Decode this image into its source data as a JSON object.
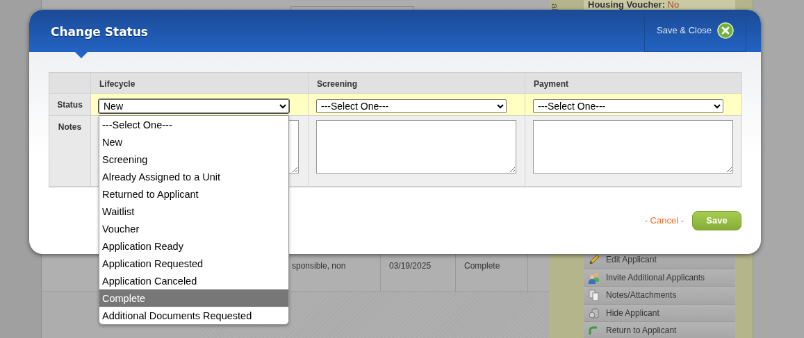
{
  "background": {
    "header_field": {
      "label": "Housing Voucher:",
      "value": "No"
    },
    "tab_label": "ai",
    "table_row": [
      "sponsible, non",
      "03/19/2025",
      "Complete"
    ],
    "side_menu": [
      {
        "label": "Edit Applicant"
      },
      {
        "label": "Invite Additional Applicants"
      },
      {
        "label": "Notes/Attachments"
      },
      {
        "label": "Hide Applicant"
      },
      {
        "label": "Return to Applicant"
      }
    ]
  },
  "modal": {
    "title": "Change Status",
    "save_close": "Save & Close",
    "columns": [
      "Lifecycle",
      "Screening",
      "Payment"
    ],
    "row_labels": [
      "Status",
      "Notes"
    ],
    "selects": [
      {
        "value": "New",
        "expanded": true
      },
      {
        "value": "---Select One---",
        "expanded": false
      },
      {
        "value": "---Select One---",
        "expanded": false
      }
    ],
    "dropdown_options": [
      {
        "label": "---Select One---",
        "highlighted": false
      },
      {
        "label": "New",
        "highlighted": false
      },
      {
        "label": "Screening",
        "highlighted": false
      },
      {
        "label": "Already Assigned to a Unit",
        "highlighted": false
      },
      {
        "label": "Returned to Applicant",
        "highlighted": false
      },
      {
        "label": "Waitlist",
        "highlighted": false
      },
      {
        "label": "Voucher",
        "highlighted": false
      },
      {
        "label": "Application Ready",
        "highlighted": false
      },
      {
        "label": "Application Requested",
        "highlighted": false
      },
      {
        "label": "Application Canceled",
        "highlighted": false
      },
      {
        "label": "Complete",
        "highlighted": true
      },
      {
        "label": "Additional Documents Requested",
        "highlighted": false
      }
    ],
    "cancel": "- Cancel -",
    "save": "Save"
  }
}
